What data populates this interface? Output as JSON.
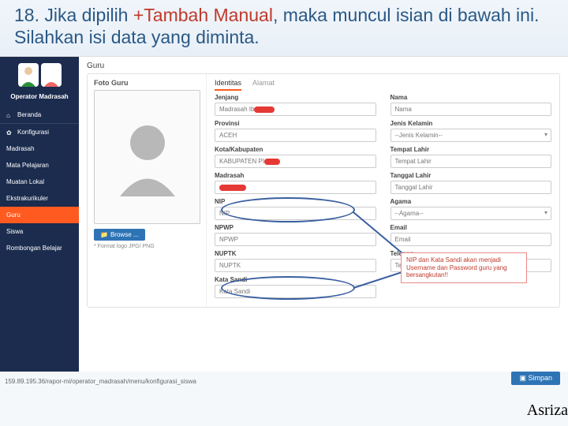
{
  "instruction": {
    "p1": "18. Jika dipilih ",
    "red": "+Tambah Manual",
    "p2": ", maka muncul isian di bawah ini. Silahkan isi data yang diminta."
  },
  "sidebar": {
    "role": "Operator Madrasah",
    "items": [
      {
        "label": "Beranda"
      },
      {
        "label": "Konfigurasi"
      },
      {
        "label": "Madrasah"
      },
      {
        "label": "Mata Pelajaran"
      },
      {
        "label": "Muatan Lokal"
      },
      {
        "label": "Ekstrakurikuler"
      },
      {
        "label": "Guru"
      },
      {
        "label": "Siswa"
      },
      {
        "label": "Rombongan Belajar"
      }
    ]
  },
  "crumb": "Guru",
  "photo": {
    "label": "Foto Guru",
    "browse": "Browse ...",
    "hint": "* Format logo JPG/ PNG"
  },
  "tabs": {
    "a": "Identitas",
    "b": "Alamat"
  },
  "left": {
    "jenjang": {
      "l": "Jenjang",
      "v": "Madrasah Ib"
    },
    "prov": {
      "l": "Provinsi",
      "v": "ACEH"
    },
    "kab": {
      "l": "Kota/Kabupaten",
      "v": "KABUPATEN PI"
    },
    "madrasah": {
      "l": "Madrasah",
      "v": ""
    },
    "nip": {
      "l": "NIP",
      "v": "NIP"
    },
    "npwp": {
      "l": "NPWP",
      "v": "NPWP"
    },
    "nuptk": {
      "l": "NUPTK",
      "v": "NUPTK"
    },
    "sandi": {
      "l": "Kata Sandi",
      "v": "Kata Sandi"
    }
  },
  "right": {
    "nama": {
      "l": "Nama",
      "v": "Nama"
    },
    "jk": {
      "l": "Jenis Kelamin",
      "v": "--Jenis Kelamin--"
    },
    "tmp": {
      "l": "Tempat Lahir",
      "v": "Tempat Lahir"
    },
    "tgl": {
      "l": "Tanggal Lahir",
      "v": "Tanggal Lahir"
    },
    "agama": {
      "l": "Agama",
      "v": "--Agama--"
    },
    "email": {
      "l": "Email",
      "v": "Email"
    },
    "tel": {
      "l": "Telepon",
      "v": "Telepon"
    }
  },
  "note": "NIP dan Kata Sandi akan menjadi Username dan Password guru yang bersangkutan!!",
  "url": "159.89.195.36/rapor-mi/operator_madrasah/menu/konfigurasi_siswa",
  "save": "Simpan",
  "author": "Asriza"
}
